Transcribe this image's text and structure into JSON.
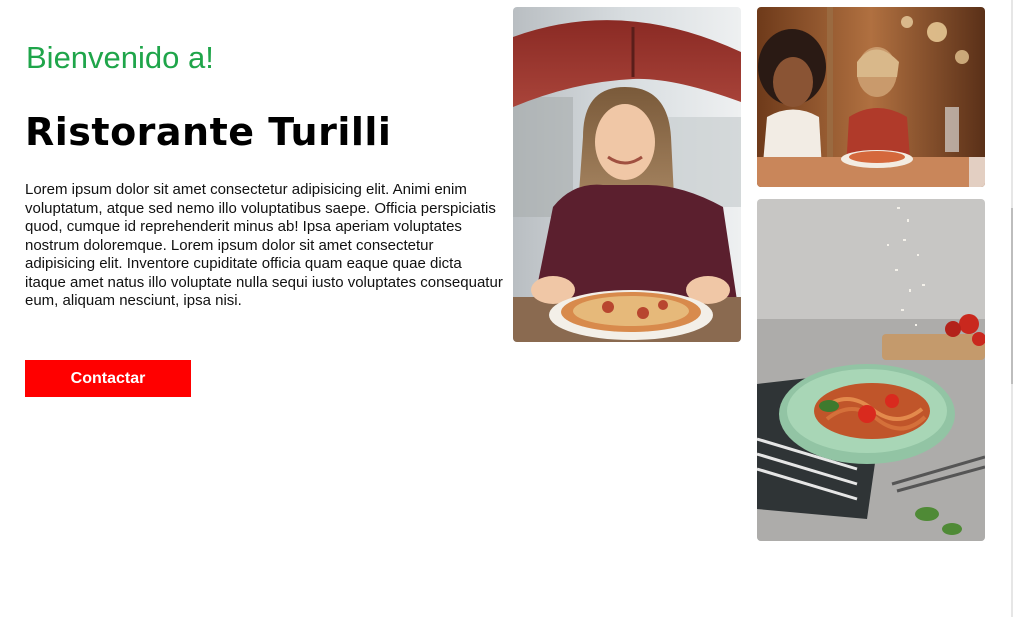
{
  "hero": {
    "welcome": "Bienvenido a!",
    "title": "Ristorante Turilli",
    "description": "Lorem ipsum dolor sit amet consectetur adipisicing elit. Animi enim voluptatum, atque sed nemo illo voluptatibus saepe. Officia perspiciatis quod, cumque id reprehenderit minus ab! Ipsa aperiam voluptates nostrum doloremque. Lorem ipsum dolor sit amet consectetur adipisicing elit. Inventore cupiditate officia quam eaque quae dicta itaque amet natus illo voluptate nulla sequi iusto voluptates consequatur eum, aliquam nesciunt, ipsa nisi.",
    "contact_label": "Contactar"
  },
  "colors": {
    "welcome": "#1fa54a",
    "button": "#ff0000",
    "button_text": "#ffffff"
  }
}
